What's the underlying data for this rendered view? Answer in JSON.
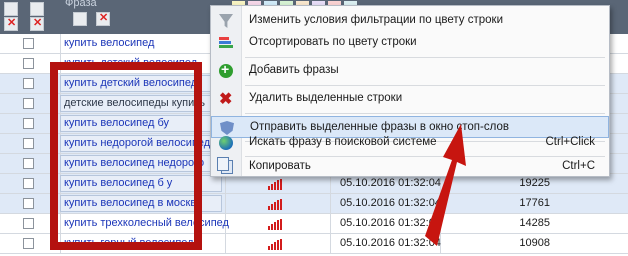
{
  "header": {
    "label": "Фраза",
    "swatch_colors": [
      "#f7f3c2",
      "#f4d6e7",
      "#cfe9f7",
      "#d6f2d3",
      "#f8e6cc",
      "#e6dcf6",
      "#f9d2d2",
      "#d9eef0"
    ]
  },
  "rows": [
    {
      "phrase": "купить велосипед",
      "date": "",
      "count": "",
      "bars": false,
      "highlight": false
    },
    {
      "phrase": "купить детский велосипед",
      "date": "",
      "count": "",
      "bars": false,
      "highlight": false
    },
    {
      "phrase": "купить детский велосипед",
      "date": "",
      "count": "",
      "bars": false,
      "highlight": true
    },
    {
      "phrase": "детские велосипеды купить",
      "date": "",
      "count": "",
      "bars": false,
      "highlight": true
    },
    {
      "phrase": "купить велосипед бу",
      "date": "",
      "count": "",
      "bars": false,
      "highlight": true
    },
    {
      "phrase": "купить недорогой велосипед",
      "date": "",
      "count": "",
      "bars": false,
      "highlight": true
    },
    {
      "phrase": "купить велосипед недорого",
      "date": "",
      "count": "",
      "bars": false,
      "highlight": true
    },
    {
      "phrase": "купить велосипед б у",
      "date": "05.10.2016 01:32:04",
      "count": "19225",
      "bars": true,
      "highlight": true
    },
    {
      "phrase": "купить велосипед в москве",
      "date": "05.10.2016 01:32:04",
      "count": "17761",
      "bars": true,
      "highlight": true
    },
    {
      "phrase": "купить трехколесный велосипед",
      "date": "05.10.2016 01:32:04",
      "count": "14285",
      "bars": true,
      "highlight": false
    },
    {
      "phrase": "купить горный велосипед",
      "date": "05.10.2016 01:32:04",
      "count": "10908",
      "bars": true,
      "highlight": false
    }
  ],
  "menu": {
    "items": [
      {
        "label": "Изменить условия фильтрации по цвету строки",
        "icon": "funnel-icon",
        "shortcut": ""
      },
      {
        "label": "Отсортировать по цвету строки",
        "icon": "sort-color-icon",
        "shortcut": ""
      },
      {
        "label": "Добавить фразы",
        "icon": "add-icon",
        "shortcut": ""
      },
      {
        "label": "Удалить выделенные строки",
        "icon": "delete-icon",
        "shortcut": ""
      },
      {
        "label": "Отправить выделенные фразы в окно стоп-слов",
        "icon": "shield-icon",
        "shortcut": ""
      },
      {
        "label": "Искать фразу в поисковой системе",
        "icon": "globe-icon",
        "shortcut": "Ctrl+Click"
      },
      {
        "label": "Копировать",
        "icon": "copy-icon",
        "shortcut": "Ctrl+C"
      }
    ]
  },
  "colors": {
    "header_bg": "#5a6676",
    "link_text": "#1b35b8",
    "annotation_red": "#b4120f",
    "menu_highlight": "#dbe8f8"
  }
}
